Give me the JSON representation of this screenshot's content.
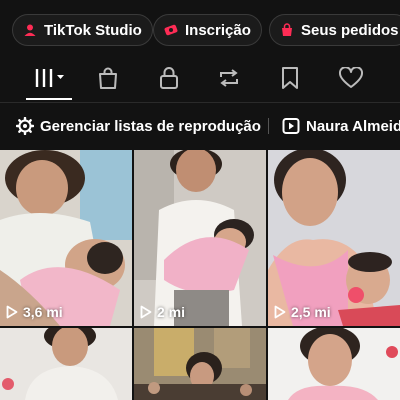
{
  "chips": [
    {
      "label": "TikTok Studio",
      "icon": "person-icon"
    },
    {
      "label": "Inscrição",
      "icon": "subscription-icon"
    },
    {
      "label": "Seus pedidos",
      "icon": "bag-icon"
    }
  ],
  "tabs": [
    "grid-icon",
    "bag-icon",
    "lock-icon",
    "repost-icon",
    "bookmark-icon",
    "heart-icon"
  ],
  "playlists": {
    "manage_label": "Gerenciar listas de reprodução",
    "playlist_label": "Naura Almeida"
  },
  "videos": [
    {
      "views": "3,6 mi"
    },
    {
      "views": "2 mi"
    },
    {
      "views": "2,5 mi"
    }
  ],
  "colors": {
    "accent": "#fe2c55",
    "background": "#121212"
  }
}
